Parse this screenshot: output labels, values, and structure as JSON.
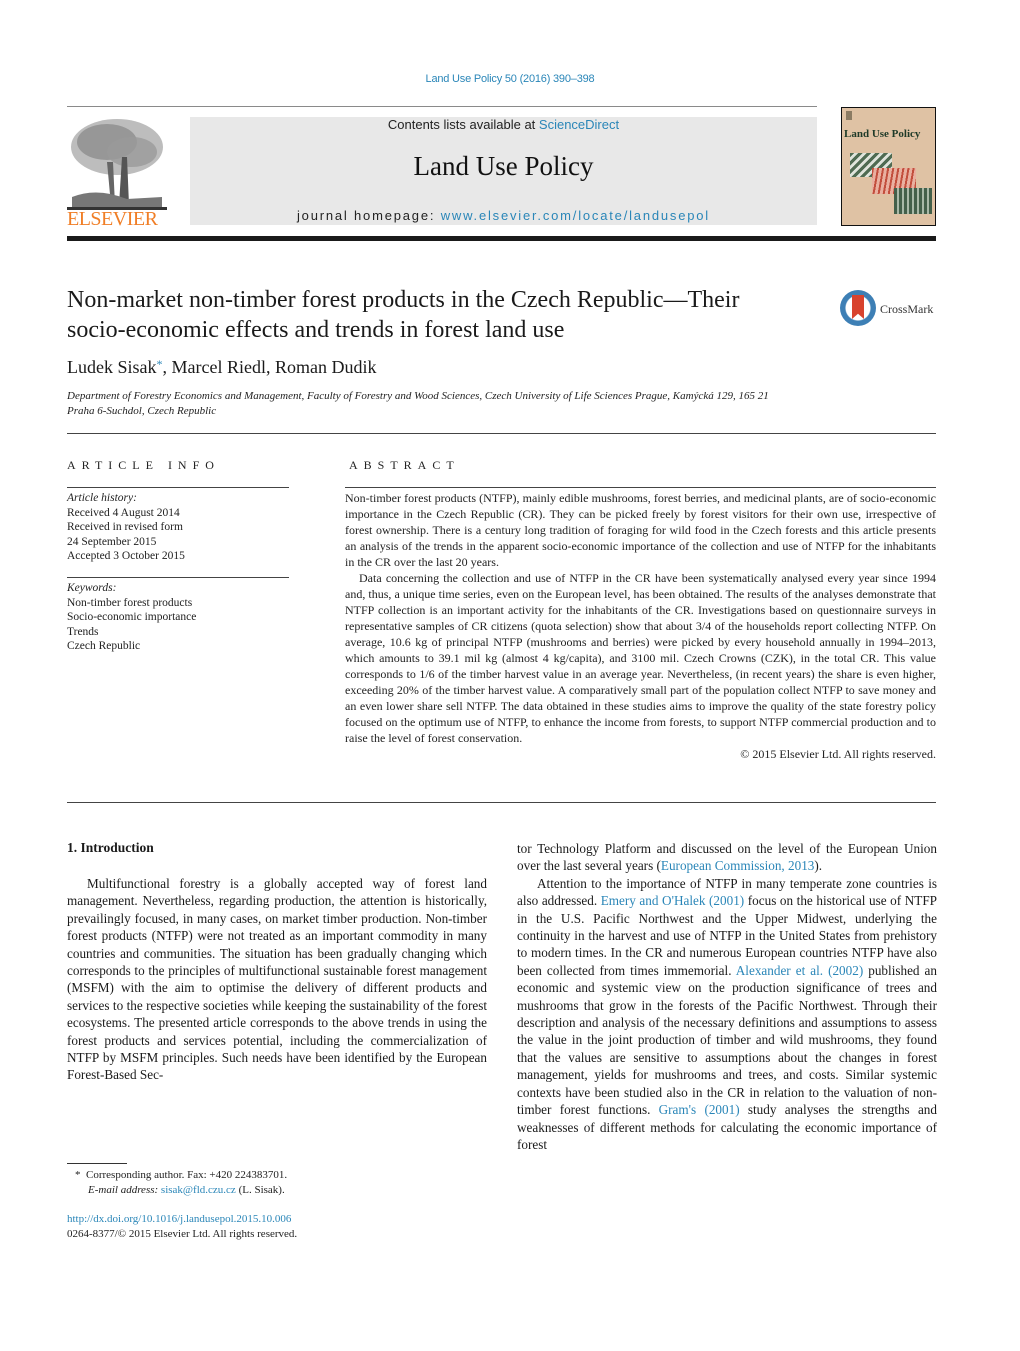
{
  "header": {
    "citation": "Land Use Policy 50 (2016) 390–398",
    "contents_prefix": "Contents lists available at ",
    "contents_link": "ScienceDirect",
    "journal_title": "Land Use Policy",
    "homepage_prefix": "journal homepage: ",
    "homepage_link": "www.elsevier.com/locate/landusepol",
    "publisher_logo_text": "ELSEVIER",
    "cover_title": "Land Use Policy",
    "colors": {
      "link": "#2a86b8",
      "elsevier_orange": "#f07e26",
      "banner_bg": "#e8e8e8",
      "cover_bg": "#dfc2a4"
    }
  },
  "article": {
    "title_line1": "Non-market non-timber forest products in the Czech Republic—Their",
    "title_line2": "socio-economic effects and trends in forest land use",
    "crossmark_label": "CrossMark",
    "authors": [
      {
        "name": "Ludek Sisak",
        "mark": "*"
      },
      {
        "name": "Marcel Riedl"
      },
      {
        "name": "Roman Dudik"
      }
    ],
    "author_sep": ", ",
    "affiliation_line1": "Department of Forestry Economics and Management, Faculty of Forestry and Wood Sciences, Czech University of Life Sciences Prague, Kamýcká 129, 165 21",
    "affiliation_line2": "Praha 6-Suchdol, Czech Republic"
  },
  "article_info": {
    "heading": "ARTICLE INFO",
    "history_label": "Article history:",
    "history": [
      "Received 4 August 2014",
      "Received in revised form",
      "24 September 2015",
      "Accepted 3 October 2015"
    ],
    "keywords_label": "Keywords:",
    "keywords": [
      "Non-timber forest products",
      "Socio-economic importance",
      "Trends",
      "Czech Republic"
    ]
  },
  "abstract": {
    "heading": "ABSTRACT",
    "paragraphs": [
      "Non-timber forest products (NTFP), mainly edible mushrooms, forest berries, and medicinal plants, are of socio-economic importance in the Czech Republic (CR). They can be picked freely by forest visitors for their own use, irrespective of forest ownership. There is a century long tradition of foraging for wild food in the Czech forests and this article presents an analysis of the trends in the apparent socio-economic importance of the collection and use of NTFP for the inhabitants in the CR over the last 20 years.",
      "Data concerning the collection and use of NTFP in the CR have been systematically analysed every year since 1994 and, thus, a unique time series, even on the European level, has been obtained. The results of the analyses demonstrate that NTFP collection is an important activity for the inhabitants of the CR. Investigations based on questionnaire surveys in representative samples of CR citizens (quota selection) show that about 3/4 of the households report collecting NTFP. On average, 10.6 kg of principal NTFP (mushrooms and berries) were picked by every household annually in 1994–2013, which amounts to 39.1 mil kg (almost 4 kg/capita), and 3100 mil. Czech Crowns (CZK), in the total CR. This value corresponds to 1/6 of the timber harvest value in an average year. Nevertheless, (in recent years) the share is even higher, exceeding 20% of the timber harvest value. A comparatively small part of the population collect NTFP to save money and an even lower share sell NTFP. The data obtained in these studies aims to improve the quality of the state forestry policy focused on the optimum use of NTFP, to enhance the income from forests, to support NTFP commercial production and to raise the level of forest conservation."
    ],
    "copyright": "© 2015 Elsevier Ltd. All rights reserved."
  },
  "body": {
    "section_heading": "1.  Introduction",
    "left_paragraph": "Multifunctional forestry is a globally accepted way of forest land management. Nevertheless, regarding production, the attention is historically, prevailingly focused, in many cases, on market timber production. Non-timber forest products (NTFP) were not treated as an important commodity in many countries and communities. The situation has been gradually changing which corresponds to the principles of multifunctional sustainable forest management (MSFM) with the aim to optimise the delivery of different products and services to the respective societies while keeping the sustainability of the forest ecosystems. The presented article corresponds to the above trends in using the forest products and services potential, including the commercialization of NTFP by MSFM principles. Such needs have been identified by the European Forest-Based Sec-",
    "right_p1_text": "tor Technology Platform and discussed on the level of the European Union over the last several years (",
    "right_p1_link": "European Commission, 2013",
    "right_p1_end": ").",
    "right_p2_a": "Attention to the importance of NTFP in many temperate zone countries is also addressed. ",
    "right_p2_link1": "Emery and O'Halek (2001)",
    "right_p2_b": " focus on the historical use of NTFP in the U.S. Pacific Northwest and the Upper Midwest, underlying the continuity in the harvest and use of NTFP in the United States from prehistory to modern times. In the CR and numerous European countries NTFP have also been collected from times immemorial. ",
    "right_p2_link2": "Alexander et al. (2002)",
    "right_p2_c": " published an economic and systemic view on the production significance of trees and mushrooms that grow in the forests of the Pacific Northwest. Through their description and analysis of the necessary definitions and assumptions to assess the value in the joint production of timber and wild mushrooms, they found that the values are sensitive to assumptions about the changes in forest management, yields for mushrooms and trees, and costs. Similar systemic contexts have been studied also in the CR in relation to the valuation of non-timber forest functions. ",
    "right_p2_link3": "Gram's (2001)",
    "right_p2_d": " study analyses the strengths and weaknesses of different methods for calculating the economic importance of forest"
  },
  "footnote": {
    "mark": "*",
    "corresponding": "Corresponding author. Fax: +420 224383701.",
    "email_label": "E-mail address: ",
    "email": "sisak@fld.czu.cz",
    "email_suffix": " (L. Sisak).",
    "doi": "http://dx.doi.org/10.1016/j.landusepol.2015.10.006",
    "issn_copyright": "0264-8377/© 2015 Elsevier Ltd. All rights reserved."
  }
}
